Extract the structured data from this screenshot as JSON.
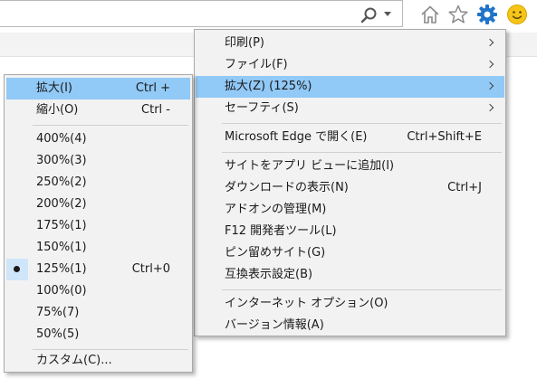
{
  "colors": {
    "highlight": "#91c9f7",
    "menu_bg": "#f2f2f2",
    "gear": "#1f73c9",
    "smiley": "#f5c518"
  },
  "toolbar": {
    "icons": [
      "search-icon",
      "dropdown-icon",
      "home-icon",
      "favorites-star-icon",
      "tools-gear-icon",
      "feedback-smiley-icon"
    ]
  },
  "tools_menu": {
    "items": [
      {
        "label": "印刷(P)",
        "shortcut": "",
        "submenu": true
      },
      {
        "label": "ファイル(F)",
        "shortcut": "",
        "submenu": true
      },
      {
        "label": "拡大(Z) (125%)",
        "shortcut": "",
        "submenu": true,
        "highlighted": true
      },
      {
        "label": "セーフティ(S)",
        "shortcut": "",
        "submenu": true
      },
      {
        "label": "Microsoft Edge で開く(E)",
        "shortcut": "Ctrl+Shift+E"
      },
      {
        "label": "サイトをアプリ ビューに追加(I)",
        "shortcut": ""
      },
      {
        "label": "ダウンロードの表示(N)",
        "shortcut": "Ctrl+J"
      },
      {
        "label": "アドオンの管理(M)",
        "shortcut": ""
      },
      {
        "label": "F12 開発者ツール(L)",
        "shortcut": ""
      },
      {
        "label": "ピン留めサイト(G)",
        "shortcut": ""
      },
      {
        "label": "互換表示設定(B)",
        "shortcut": ""
      },
      {
        "label": "インターネット オプション(O)",
        "shortcut": ""
      },
      {
        "label": "バージョン情報(A)",
        "shortcut": ""
      }
    ]
  },
  "zoom_menu": {
    "items": [
      {
        "label": "拡大(I)",
        "shortcut": "Ctrl +",
        "highlighted": true
      },
      {
        "label": "縮小(O)",
        "shortcut": "Ctrl -"
      },
      {
        "label": "400%(4)",
        "shortcut": ""
      },
      {
        "label": "300%(3)",
        "shortcut": ""
      },
      {
        "label": "250%(2)",
        "shortcut": ""
      },
      {
        "label": "200%(2)",
        "shortcut": ""
      },
      {
        "label": "175%(1)",
        "shortcut": ""
      },
      {
        "label": "150%(1)",
        "shortcut": ""
      },
      {
        "label": "125%(1)",
        "shortcut": "Ctrl+0",
        "checked": true
      },
      {
        "label": "100%(0)",
        "shortcut": ""
      },
      {
        "label": "75%(7)",
        "shortcut": ""
      },
      {
        "label": "50%(5)",
        "shortcut": ""
      },
      {
        "label": "カスタム(C)...",
        "shortcut": ""
      }
    ]
  }
}
